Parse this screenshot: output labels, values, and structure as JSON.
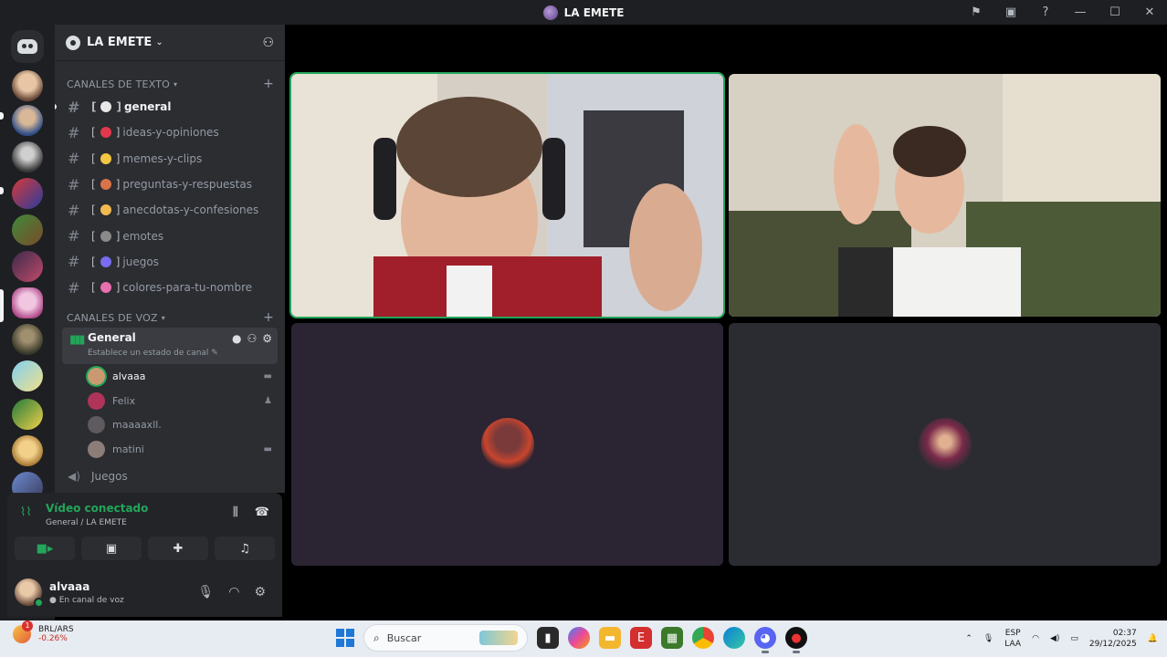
{
  "window": {
    "title": "LA EMETE"
  },
  "server": {
    "name": "LA EMETE"
  },
  "text_category": {
    "label": "CANALES DE TEXTO"
  },
  "text_channels": [
    {
      "name": "general",
      "emoji_color": "#e8e8e8"
    },
    {
      "name": "ideas-y-opiniones",
      "emoji_color": "#e0394c"
    },
    {
      "name": "memes-y-clips",
      "emoji_color": "#f2c744"
    },
    {
      "name": "preguntas-y-respuestas",
      "emoji_color": "#d9734a"
    },
    {
      "name": "anecdotas-y-confesiones",
      "emoji_color": "#f2b950"
    },
    {
      "name": "emotes",
      "emoji_color": "#8a8a8a"
    },
    {
      "name": "juegos",
      "emoji_color": "#7a6cf0"
    },
    {
      "name": "colores-para-tu-nombre",
      "emoji_color": "#e86fb0"
    }
  ],
  "voice_category": {
    "label": "CANALES DE VOZ"
  },
  "voice_channel": {
    "name": "General",
    "status_placeholder": "Establece un estado de canal"
  },
  "voice_users": [
    {
      "name": "alvaaa",
      "avatar": "#c99a70"
    },
    {
      "name": "Felix",
      "avatar": "#b0345a"
    },
    {
      "name": "maaaaxll.",
      "avatar": "#5e5a5e"
    },
    {
      "name": "matini",
      "avatar": "#8d7d78"
    }
  ],
  "other_voice_channel": {
    "name": "Juegos"
  },
  "voice_panel": {
    "title": "Vídeo conectado",
    "subtitle": "General / LA EMETE"
  },
  "user_panel": {
    "name": "alvaaa",
    "status": "En canal de voz"
  },
  "taskbar": {
    "ticker": "BRL/ARS",
    "ticker_change": "-0.26%",
    "badge": "1",
    "search_placeholder": "Buscar",
    "lang_top": "ESP",
    "lang_bottom": "LAA",
    "time": "02:37",
    "date": "29/12/2025"
  },
  "colors": {
    "accent_green": "#23a55a",
    "sidebar_bg": "#2b2d31",
    "rail_bg": "#1e1f22"
  }
}
